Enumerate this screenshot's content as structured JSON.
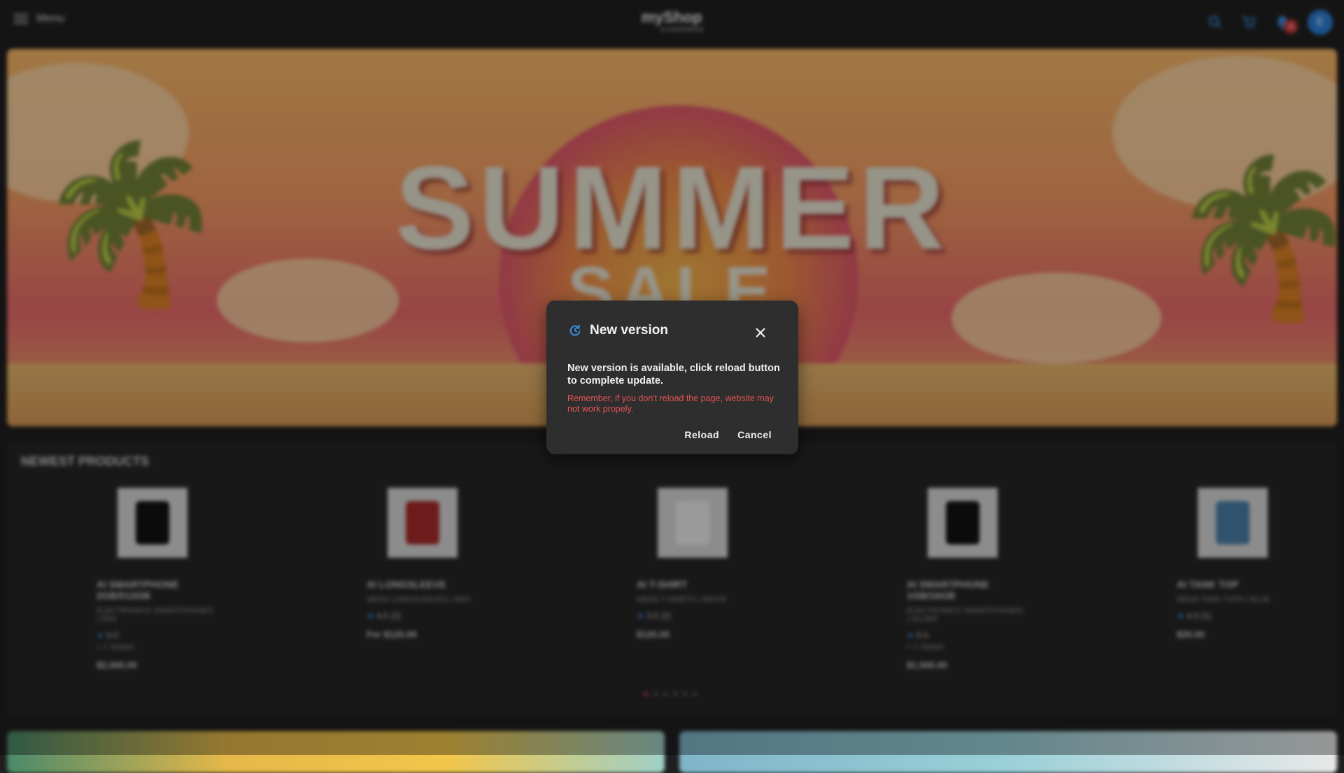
{
  "header": {
    "menu_label": "Menu",
    "logo_main": "myShop",
    "logo_sub": "e-commerce",
    "notification_count": "4",
    "avatar_initial": "E",
    "icons": [
      "hamburger-icon",
      "search-icon",
      "cart-icon",
      "bell-icon"
    ],
    "accent_color": "#3a8de0"
  },
  "hero": {
    "title": "SUMMER",
    "subtitle": "SALE"
  },
  "products": {
    "heading": "NEWEST PRODUCTS",
    "items": [
      {
        "name": "AI SMARTPHONE 2GB/512GB",
        "category": "ELECTRONICS SMARTPHONES | RED",
        "rating": "0.0",
        "variant": "+ 1 Variant",
        "price": "$2,000.00"
      },
      {
        "name": "AI LONGSLEEVE",
        "category": "MENS LONGSLEEVES | RED",
        "rating": "4.5 (2)",
        "variant": "",
        "price": "For $120.00"
      },
      {
        "name": "AI T-SHIRT",
        "category": "MENS T-SHIRTS | WHITE",
        "rating": "3.5 (2)",
        "variant": "",
        "price": "$120.00"
      },
      {
        "name": "AI SMARTPHONE 1GB/16GB",
        "category": "ELECTRONICS SMARTPHONES | SILVER",
        "rating": "0.0",
        "variant": "+ 1 Variant",
        "price": "$1,500.00"
      },
      {
        "name": "AI TANK TOP",
        "category": "MENS TANK TOPS | BLUE",
        "rating": "4.0 (1)",
        "variant": "",
        "price": "$20.00"
      }
    ],
    "active_page": 1,
    "page_count": 6
  },
  "dialog": {
    "title": "New version",
    "message": "New version is available, click reload button to complete update.",
    "warning": "Remember, if you don't reload the page, website may not work propely.",
    "reload_label": "Reload",
    "cancel_label": "Cancel",
    "warning_color": "#e55353"
  }
}
